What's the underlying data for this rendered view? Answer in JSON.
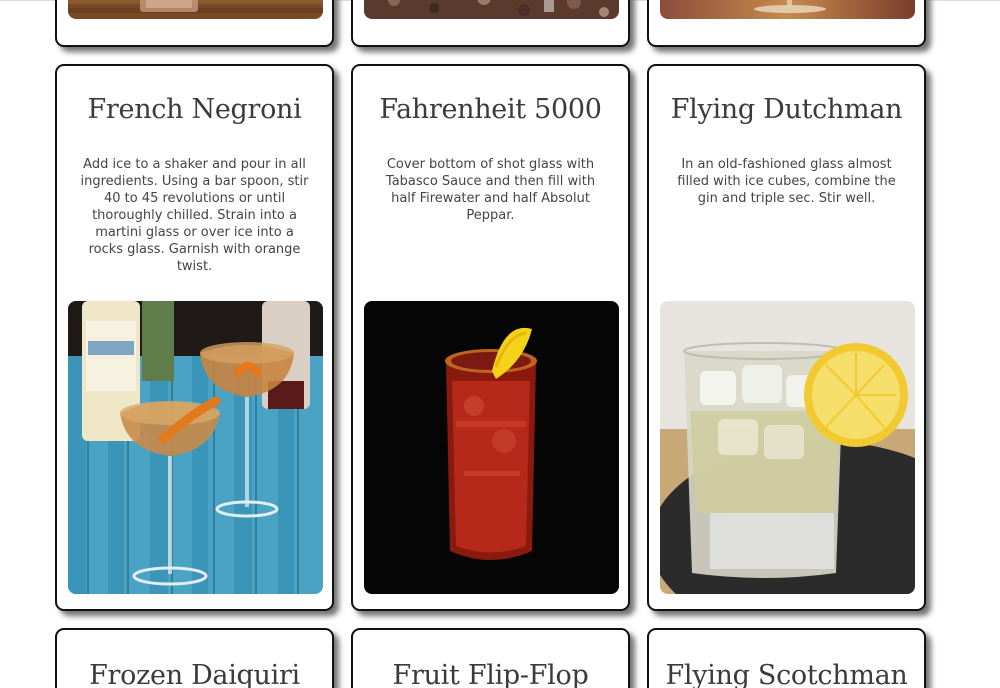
{
  "top_row": [
    {
      "photo": "whiskey-glass-on-wood-photo"
    },
    {
      "photo": "glass-on-granite-photo"
    },
    {
      "photo": "coupe-glass-on-brown-photo"
    }
  ],
  "middle_row": [
    {
      "title": "French Negroni",
      "description": "Add ice to a shaker and pour in all ingredients. Using a bar spoon, stir 40 to 45 revolutions or until thoroughly chilled. Strain into a martini glass or over ice into a rocks glass. Garnish with orange twist.",
      "photo": "two-coupe-glasses-with-orange-twist-on-blue-wood-photo"
    },
    {
      "title": "Fahrenheit 5000",
      "description": "Cover bottom of shot glass with Tabasco Sauce and then fill with half Firewater and half Absolut Peppar.",
      "photo": "red-drink-with-lemon-wedge-black-background-photo"
    },
    {
      "title": "Flying Dutchman",
      "description": "In an old-fashioned glass almost filled with ice cubes, combine the gin and triple sec. Stir well.",
      "photo": "rocks-glass-with-lemon-slice-on-tray-photo"
    }
  ],
  "bottom_row": [
    {
      "title": "Frozen Daiquiri"
    },
    {
      "title": "Fruit Flip-Flop"
    },
    {
      "title": "Flying Scotchman"
    }
  ],
  "colors": {
    "card_border": "#111111",
    "title_text": "#3b3b3b",
    "body_text": "#444444",
    "background": "#ffffff"
  }
}
